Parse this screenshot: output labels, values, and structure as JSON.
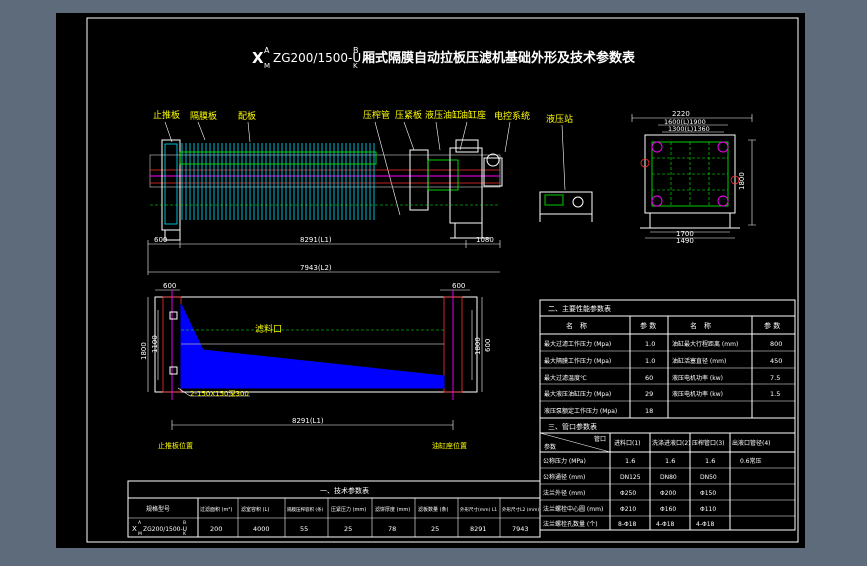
{
  "drawing": {
    "title_prefix": "X",
    "title_sup_a": "A",
    "title_sub_m": "M",
    "title_model": "ZG200/1500-U",
    "title_sup_b": "B",
    "title_sub_k": "K",
    "title_rest": "厢式隔膜自动拉板压滤机基础外形及技术参数表",
    "callouts": {
      "stop_plate": "止推板",
      "membrane_plate": "隔膜板",
      "filter_plate": "配板",
      "press_pipe": "压榨管",
      "press_board": "压紧板",
      "hydraulic_cyl": "液压油缸",
      "cylinder_seat": "油缸座",
      "electric": "电控系统",
      "hydraulic_station": "液压站",
      "feed_port": "滤料口",
      "slot_note": "2-150X150深300",
      "foundation_left": "止推板位置",
      "foundation_right": "油缸座位置"
    },
    "dims": {
      "d600_left": "600",
      "d8291_top": "8291(L1)",
      "d1080": "1080",
      "d7943": "7943(L2)",
      "d2220": "2220",
      "d1900": "1600(L)1900",
      "d1300": "1300(L)1360",
      "d1800v": "1800",
      "d1700": "1700",
      "d1490": "1490",
      "d600_a": "600",
      "d600_b": "600",
      "d1800_left": "1800",
      "d1100_left": "1100",
      "d1800_right": "1800",
      "d600_right": "600",
      "d8291_bottom": "8291(L1)"
    },
    "main_params": {
      "title": "二、主要性能参数表",
      "headers": [
        "名　称",
        "参 数",
        "名　称",
        "参 数"
      ],
      "rows": [
        [
          "最大过滤工作压力 (Mpa)",
          "1.0",
          "油缸最大行程距离 (mm)",
          "800"
        ],
        [
          "最大隔膜工作压力 (Mpa)",
          "1.0",
          "油缸活塞直径 (mm)",
          "450"
        ],
        [
          "最大过滤温度℃",
          "60",
          "液压电机功率 (kw)",
          "7.5"
        ],
        [
          "最大液压油缸压力 (Mpa)",
          "29",
          "液压电机功率 (kw)",
          "1.5"
        ],
        [
          "液压泵额定工作压力 (Mpa)",
          "18",
          "",
          ""
        ]
      ]
    },
    "ports": {
      "title": "三、管口参数表",
      "corner_top": "管口",
      "corner_bottom": "参数",
      "headers": [
        "进料口(1)",
        "洗涤进液口(2)",
        "压榨管口(3)",
        "出液口管径(4)"
      ],
      "rows": [
        [
          "公称压力 (MPa)",
          "1.6",
          "1.6",
          "1.6",
          "0.6常压"
        ],
        [
          "公称通径 (mm)",
          "DN125",
          "DN80",
          "DN50",
          ""
        ],
        [
          "法兰外径 (mm)",
          "Φ250",
          "Φ200",
          "Φ150",
          ""
        ],
        [
          "法兰螺栓中心圆 (mm)",
          "Φ210",
          "Φ160",
          "Φ110",
          ""
        ],
        [
          "法兰螺栓孔数量 (个)",
          "8-Φ18",
          "4-Φ18",
          "4-Φ18",
          ""
        ]
      ]
    },
    "tech": {
      "title": "一、技术参数表",
      "headers": [
        "规格型号",
        "过滤面积 (m²)",
        "滤室容积 (L)",
        "隔膜压榨容积 (条)",
        "压紧压力 (mm)",
        "滤饼厚度 (mm)",
        "滤板数量 (条)",
        "外形尺寸(mm) L1",
        "外形尺寸L2 (mm)"
      ],
      "model_prefix": "X",
      "model_sup_a": "A",
      "model_sub_m": "M",
      "model_main": "ZG200/1500-U",
      "model_sup_b": "B",
      "model_sub_k": "K",
      "values": [
        "200",
        "4000",
        "55",
        "25",
        "78",
        "25",
        "8291",
        "7943"
      ]
    }
  }
}
